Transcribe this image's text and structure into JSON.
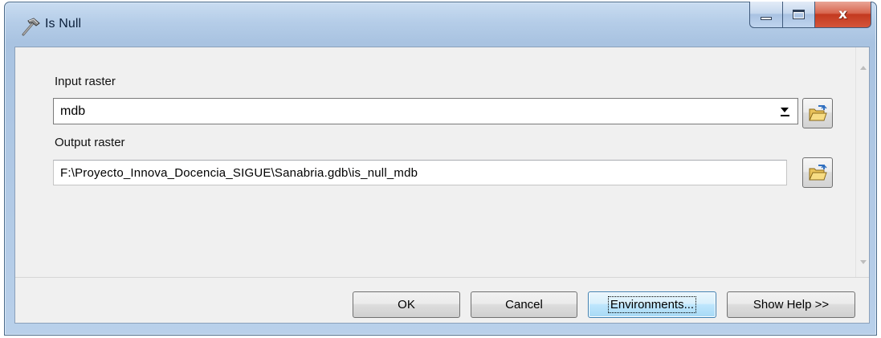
{
  "window": {
    "title": "Is Null",
    "title_icon": "hammer-icon",
    "controls": {
      "minimize": "minimize-icon",
      "maximize": "maximize-icon",
      "close": "x"
    }
  },
  "form": {
    "input_raster": {
      "label": "Input raster",
      "value": "mdb",
      "browse_icon": "open-folder-icon"
    },
    "output_raster": {
      "label": "Output raster",
      "value": "F:\\Proyecto_Innova_Docencia_SIGUE\\Sanabria.gdb\\is_null_mdb",
      "browse_icon": "open-folder-icon"
    }
  },
  "buttons": {
    "ok": "OK",
    "cancel": "Cancel",
    "environments": "Environments...",
    "show_help": "Show Help >>"
  },
  "colors": {
    "titlebar": "#b5cde8",
    "close_button": "#c3391f",
    "focused_button_border": "#3c7fb1",
    "client_background": "#f0f0f0"
  }
}
